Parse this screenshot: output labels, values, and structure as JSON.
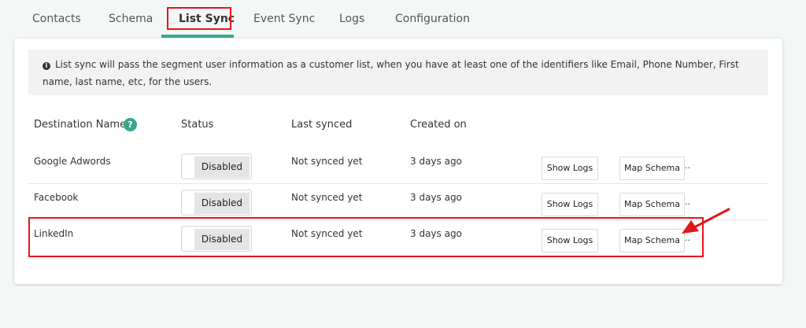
{
  "tabs": [
    {
      "label": "Contacts",
      "active": false
    },
    {
      "label": "Schema",
      "active": false
    },
    {
      "label": "List Sync",
      "active": true
    },
    {
      "label": "Event Sync",
      "active": false
    },
    {
      "label": "Logs",
      "active": false
    },
    {
      "label": "Configuration",
      "active": false
    }
  ],
  "info": {
    "icon": "info-icon",
    "text": "List sync will pass the segment user information as a customer list, when you have at least one of the identifiers like Email, Phone Number, First name, last name, etc, for the users."
  },
  "table": {
    "headers": {
      "destination": "Destination Name",
      "status": "Status",
      "last_synced": "Last synced",
      "created_on": "Created on"
    },
    "help_icon": "?",
    "rows": [
      {
        "name": "Google Adwords",
        "status": "Disabled",
        "last_synced": "Not synced yet",
        "created_on": "3 days ago",
        "logs_label": "Show Logs",
        "map_label": "Map Schema",
        "more": ".."
      },
      {
        "name": "Facebook",
        "status": "Disabled",
        "last_synced": "Not synced yet",
        "created_on": "3 days ago",
        "logs_label": "Show Logs",
        "map_label": "Map Schema",
        "more": ".."
      },
      {
        "name": "LinkedIn",
        "status": "Disabled",
        "last_synced": "Not synced yet",
        "created_on": "3 days ago",
        "logs_label": "Show Logs",
        "map_label": "Map Schema",
        "more": ".."
      }
    ]
  },
  "colors": {
    "accent": "#3aa58f",
    "highlight": "#e8141b",
    "background": "#f3f8f6"
  }
}
